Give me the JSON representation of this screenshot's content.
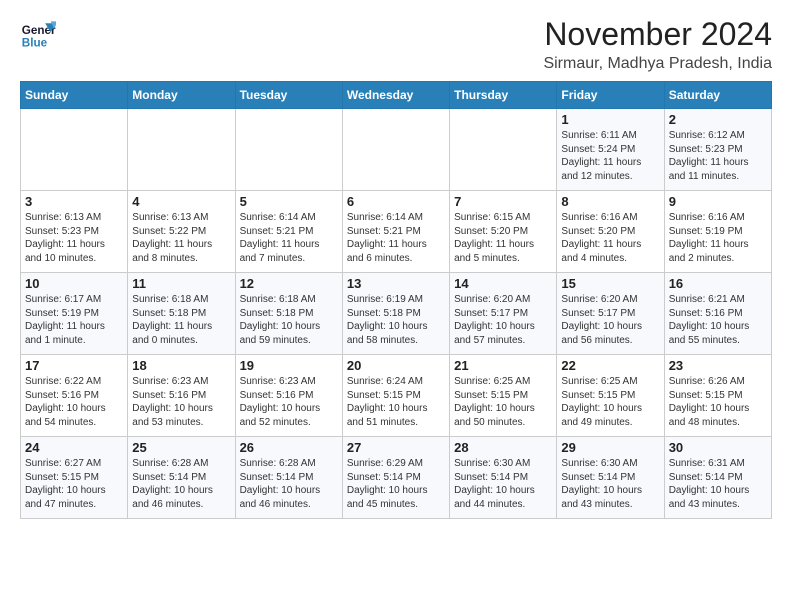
{
  "logo": {
    "line1": "General",
    "line2": "Blue"
  },
  "header": {
    "month": "November 2024",
    "location": "Sirmaur, Madhya Pradesh, India"
  },
  "weekdays": [
    "Sunday",
    "Monday",
    "Tuesday",
    "Wednesday",
    "Thursday",
    "Friday",
    "Saturday"
  ],
  "weeks": [
    [
      {
        "day": "",
        "info": ""
      },
      {
        "day": "",
        "info": ""
      },
      {
        "day": "",
        "info": ""
      },
      {
        "day": "",
        "info": ""
      },
      {
        "day": "",
        "info": ""
      },
      {
        "day": "1",
        "info": "Sunrise: 6:11 AM\nSunset: 5:24 PM\nDaylight: 11 hours\nand 12 minutes."
      },
      {
        "day": "2",
        "info": "Sunrise: 6:12 AM\nSunset: 5:23 PM\nDaylight: 11 hours\nand 11 minutes."
      }
    ],
    [
      {
        "day": "3",
        "info": "Sunrise: 6:13 AM\nSunset: 5:23 PM\nDaylight: 11 hours\nand 10 minutes."
      },
      {
        "day": "4",
        "info": "Sunrise: 6:13 AM\nSunset: 5:22 PM\nDaylight: 11 hours\nand 8 minutes."
      },
      {
        "day": "5",
        "info": "Sunrise: 6:14 AM\nSunset: 5:21 PM\nDaylight: 11 hours\nand 7 minutes."
      },
      {
        "day": "6",
        "info": "Sunrise: 6:14 AM\nSunset: 5:21 PM\nDaylight: 11 hours\nand 6 minutes."
      },
      {
        "day": "7",
        "info": "Sunrise: 6:15 AM\nSunset: 5:20 PM\nDaylight: 11 hours\nand 5 minutes."
      },
      {
        "day": "8",
        "info": "Sunrise: 6:16 AM\nSunset: 5:20 PM\nDaylight: 11 hours\nand 4 minutes."
      },
      {
        "day": "9",
        "info": "Sunrise: 6:16 AM\nSunset: 5:19 PM\nDaylight: 11 hours\nand 2 minutes."
      }
    ],
    [
      {
        "day": "10",
        "info": "Sunrise: 6:17 AM\nSunset: 5:19 PM\nDaylight: 11 hours\nand 1 minute."
      },
      {
        "day": "11",
        "info": "Sunrise: 6:18 AM\nSunset: 5:18 PM\nDaylight: 11 hours\nand 0 minutes."
      },
      {
        "day": "12",
        "info": "Sunrise: 6:18 AM\nSunset: 5:18 PM\nDaylight: 10 hours\nand 59 minutes."
      },
      {
        "day": "13",
        "info": "Sunrise: 6:19 AM\nSunset: 5:18 PM\nDaylight: 10 hours\nand 58 minutes."
      },
      {
        "day": "14",
        "info": "Sunrise: 6:20 AM\nSunset: 5:17 PM\nDaylight: 10 hours\nand 57 minutes."
      },
      {
        "day": "15",
        "info": "Sunrise: 6:20 AM\nSunset: 5:17 PM\nDaylight: 10 hours\nand 56 minutes."
      },
      {
        "day": "16",
        "info": "Sunrise: 6:21 AM\nSunset: 5:16 PM\nDaylight: 10 hours\nand 55 minutes."
      }
    ],
    [
      {
        "day": "17",
        "info": "Sunrise: 6:22 AM\nSunset: 5:16 PM\nDaylight: 10 hours\nand 54 minutes."
      },
      {
        "day": "18",
        "info": "Sunrise: 6:23 AM\nSunset: 5:16 PM\nDaylight: 10 hours\nand 53 minutes."
      },
      {
        "day": "19",
        "info": "Sunrise: 6:23 AM\nSunset: 5:16 PM\nDaylight: 10 hours\nand 52 minutes."
      },
      {
        "day": "20",
        "info": "Sunrise: 6:24 AM\nSunset: 5:15 PM\nDaylight: 10 hours\nand 51 minutes."
      },
      {
        "day": "21",
        "info": "Sunrise: 6:25 AM\nSunset: 5:15 PM\nDaylight: 10 hours\nand 50 minutes."
      },
      {
        "day": "22",
        "info": "Sunrise: 6:25 AM\nSunset: 5:15 PM\nDaylight: 10 hours\nand 49 minutes."
      },
      {
        "day": "23",
        "info": "Sunrise: 6:26 AM\nSunset: 5:15 PM\nDaylight: 10 hours\nand 48 minutes."
      }
    ],
    [
      {
        "day": "24",
        "info": "Sunrise: 6:27 AM\nSunset: 5:15 PM\nDaylight: 10 hours\nand 47 minutes."
      },
      {
        "day": "25",
        "info": "Sunrise: 6:28 AM\nSunset: 5:14 PM\nDaylight: 10 hours\nand 46 minutes."
      },
      {
        "day": "26",
        "info": "Sunrise: 6:28 AM\nSunset: 5:14 PM\nDaylight: 10 hours\nand 46 minutes."
      },
      {
        "day": "27",
        "info": "Sunrise: 6:29 AM\nSunset: 5:14 PM\nDaylight: 10 hours\nand 45 minutes."
      },
      {
        "day": "28",
        "info": "Sunrise: 6:30 AM\nSunset: 5:14 PM\nDaylight: 10 hours\nand 44 minutes."
      },
      {
        "day": "29",
        "info": "Sunrise: 6:30 AM\nSunset: 5:14 PM\nDaylight: 10 hours\nand 43 minutes."
      },
      {
        "day": "30",
        "info": "Sunrise: 6:31 AM\nSunset: 5:14 PM\nDaylight: 10 hours\nand 43 minutes."
      }
    ]
  ]
}
